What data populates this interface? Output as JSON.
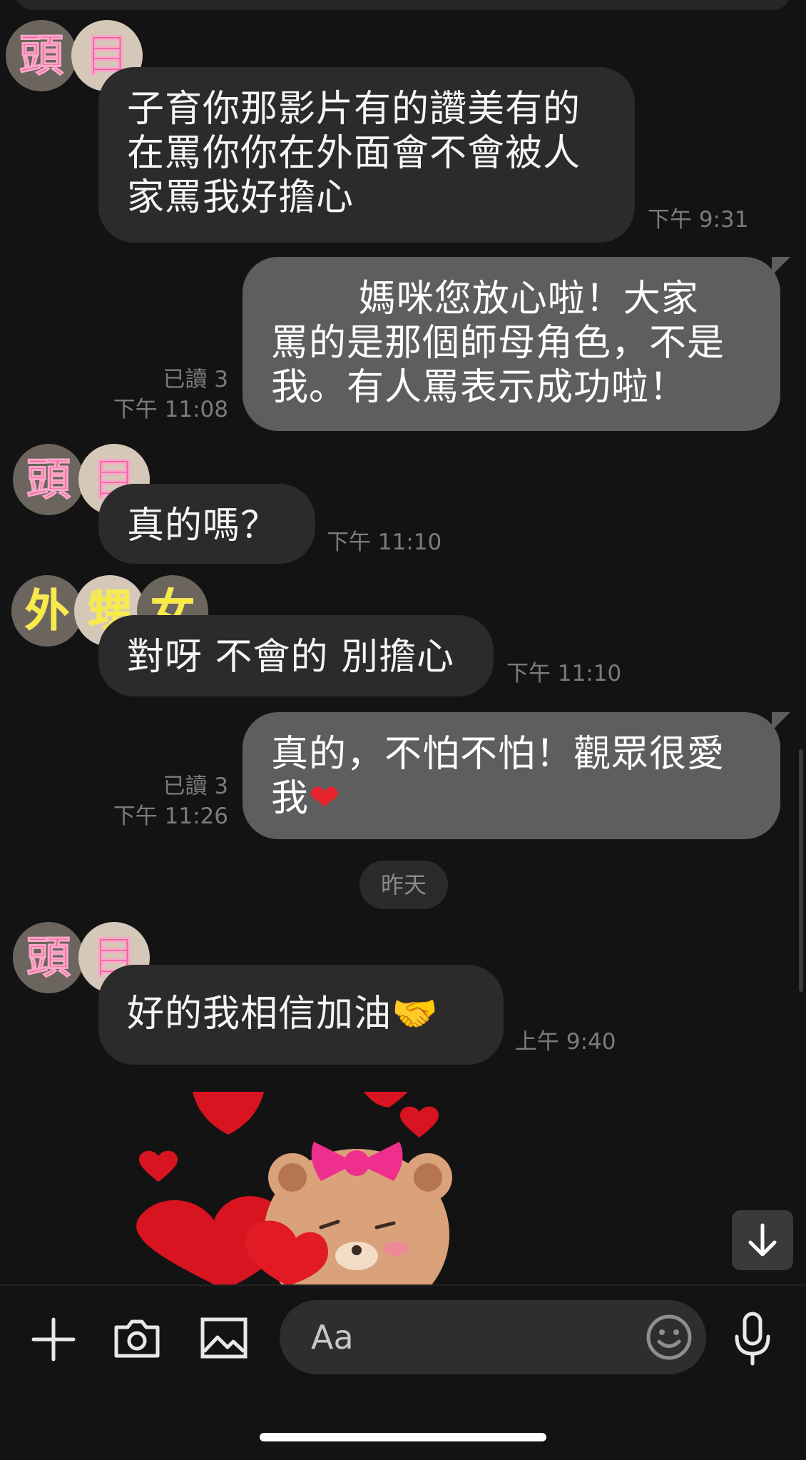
{
  "messages": [
    {
      "sender": "頭目",
      "direction": "incoming",
      "lines": [
        "子育你那影片有的讚美有的",
        "在罵你你在外面會不會被人",
        "家罵我好擔心"
      ],
      "time": "下午 9:31"
    },
    {
      "direction": "outgoing",
      "lines": [
        "       媽咪您放心啦！大家",
        "罵的是那個師母角色，不是",
        "我。有人罵表示成功啦！"
      ],
      "read": "已讀 3",
      "time": "下午 11:08"
    },
    {
      "sender": "頭目",
      "direction": "incoming",
      "lines": [
        "真的嗎？"
      ],
      "time": "下午 11:10"
    },
    {
      "sender": "外甥女",
      "direction": "incoming",
      "lines": [
        "對呀 不會的 別擔心"
      ],
      "time": "下午 11:10"
    },
    {
      "direction": "outgoing",
      "lines": [
        "真的，不怕不怕！觀眾很愛",
        "我"
      ],
      "emoji": "❤",
      "read": "已讀 3",
      "time": "下午 11:26"
    },
    {
      "sender": "頭目",
      "direction": "incoming",
      "lines": [
        "好的我相信加油"
      ],
      "emoji": "🤝",
      "time": "上午 9:40"
    }
  ],
  "avatars": {
    "toumu": [
      "頭",
      "目"
    ],
    "niece": [
      "外",
      "甥",
      "女"
    ]
  },
  "date_divider": "昨天",
  "composer": {
    "placeholder": "Aa"
  },
  "icons": {
    "add": "plus-icon",
    "camera": "camera-icon",
    "gallery": "image-icon",
    "emoji": "smiley-icon",
    "mic": "microphone-icon",
    "scroll_down": "arrow-down-icon"
  },
  "colors": {
    "background": "#131313",
    "incoming_bubble": "#2b2b2b",
    "outgoing_bubble": "#5e5e5e",
    "avatar_pink": "#f0609e",
    "avatar_yellow": "#fbef2c"
  }
}
